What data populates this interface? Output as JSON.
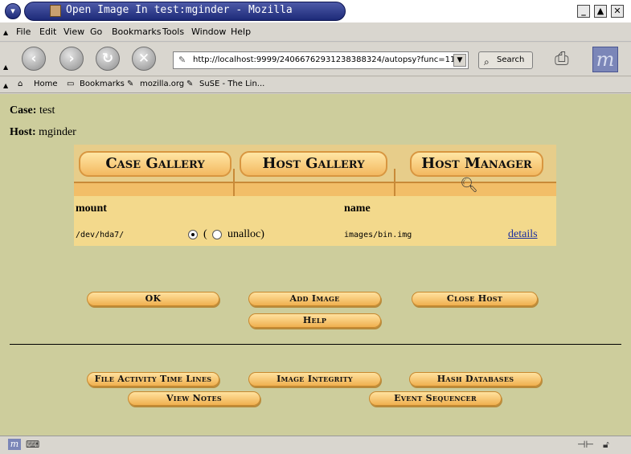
{
  "window": {
    "title": "Open Image In test:mginder - Mozilla",
    "controls": [
      "_",
      "▲",
      "✕"
    ]
  },
  "menubar": [
    "File",
    "Edit",
    "View",
    "Go",
    "Bookmarks",
    "Tools",
    "Window",
    "Help"
  ],
  "navbar": {
    "url": "http://localhost:9999/24066762931238388324/autopsy?func=11&ca",
    "search_label": "Search"
  },
  "personal_toolbar": {
    "home": "Home",
    "bookmarks": "Bookmarks",
    "link1": "mozilla.org",
    "link2": "SuSE - The Lin..."
  },
  "page": {
    "case_label": "Case:",
    "case_value": "test",
    "host_label": "Host:",
    "host_value": "mginder",
    "tabs": [
      "Case Gallery",
      "Host Gallery",
      "Host Manager"
    ],
    "table": {
      "col_mount": "mount",
      "col_name": "name",
      "mount_value": "/dev/hda7/",
      "paren_open": "(",
      "unalloc_label": "unalloc)",
      "name_value": "images/bin.img",
      "details_link": "details"
    },
    "buttons": {
      "ok": "OK",
      "add_image": "Add Image",
      "close_host": "Close Host",
      "help": "Help",
      "file_activity": "File Activity Time Lines",
      "image_integrity": "Image Integrity",
      "hash_databases": "Hash Databases",
      "view_notes": "View Notes",
      "event_sequencer": "Event Sequencer"
    }
  }
}
